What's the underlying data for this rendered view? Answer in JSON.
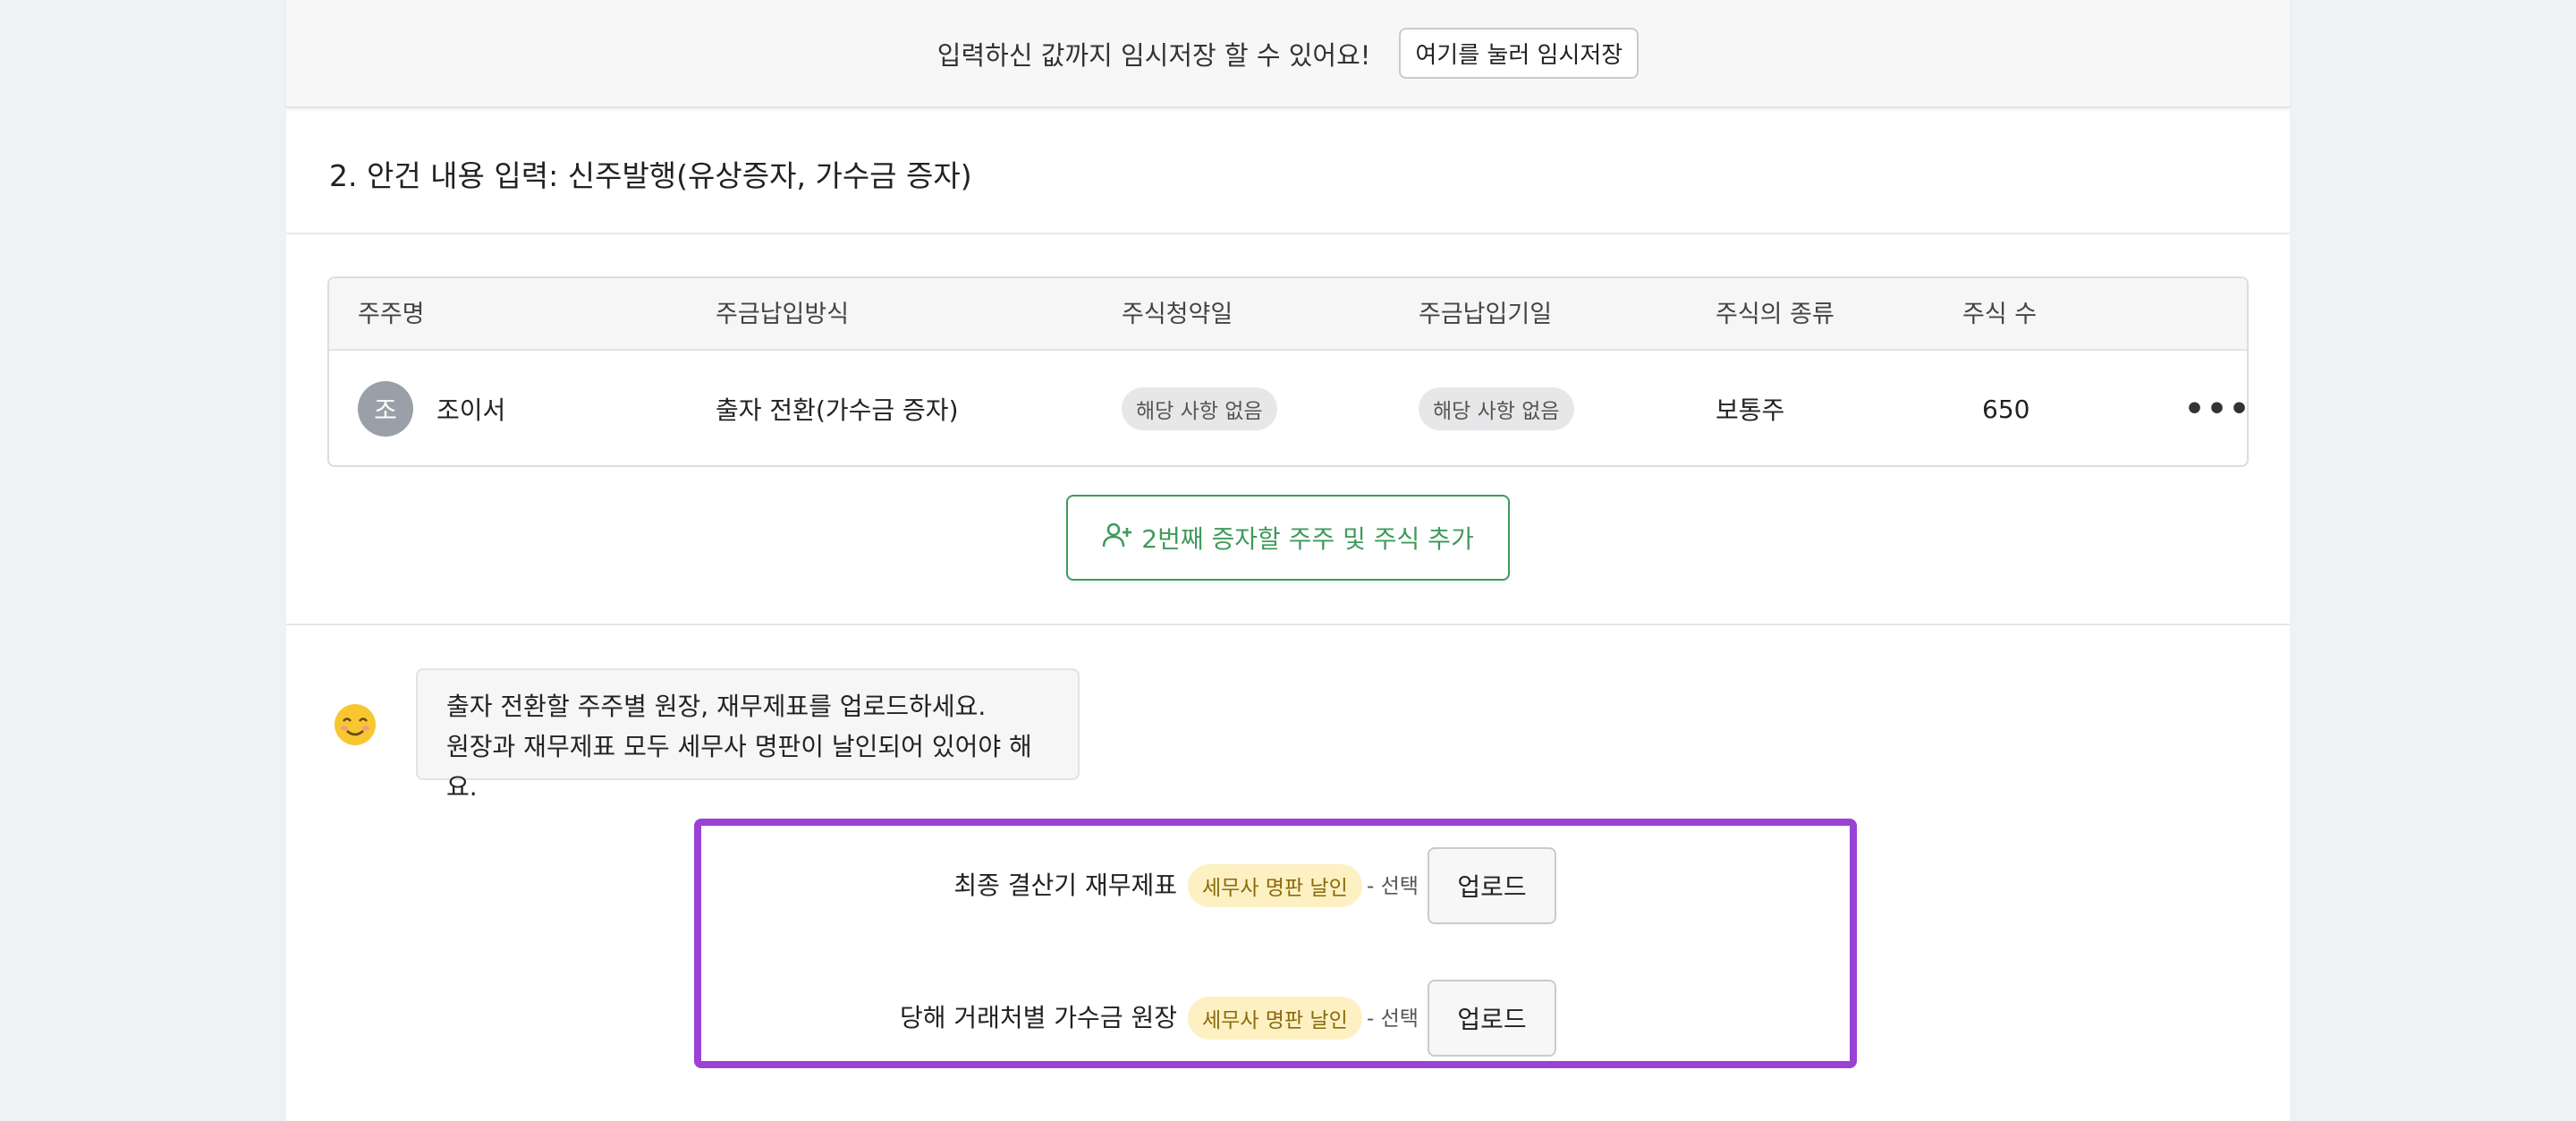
{
  "save_bar": {
    "message": "입력하신 값까지 임시저장 할 수 있어요!",
    "button_label": "여기를 눌러 임시저장"
  },
  "section": {
    "title": "2. 안건 내용 입력: 신주발행(유상증자, 가수금 증자)"
  },
  "table": {
    "headers": [
      "주주명",
      "주금납입방식",
      "주식청약일",
      "주금납입기일",
      "주식의 종류",
      "주식 수"
    ],
    "rows": [
      {
        "avatar": "조",
        "name": "조이서",
        "payment_method": "출자 전환(가수금 증자)",
        "subscription_date": "해당 사항 없음",
        "payment_due_date": "해당 사항 없음",
        "share_type": "보통주",
        "share_count": "650",
        "more": "•••"
      }
    ]
  },
  "add_button": {
    "label": "2번째 증자할 주주 및 주식 추가",
    "icon": "user-plus-icon"
  },
  "guide": {
    "emoji": "smiling-face-icon",
    "line1": "출자 전환할 주주별 원장, 재무제표를 업로드하세요.",
    "line2": "원장과 재무제표 모두 세무사 명판이 날인되어 있어야 해요."
  },
  "uploads": [
    {
      "label": "최종 결산기 재무제표",
      "badge": "세무사 명판 날인",
      "optional": "- 선택",
      "button": "업로드"
    },
    {
      "label": "당해 거래처별 가수금 원장",
      "badge": "세무사 명판 날인",
      "optional": "- 선택",
      "button": "업로드"
    }
  ],
  "colors": {
    "accent_green": "#3f9b5b",
    "highlight_purple": "#9b41d4",
    "badge_yellow": "#fdf0c2"
  }
}
